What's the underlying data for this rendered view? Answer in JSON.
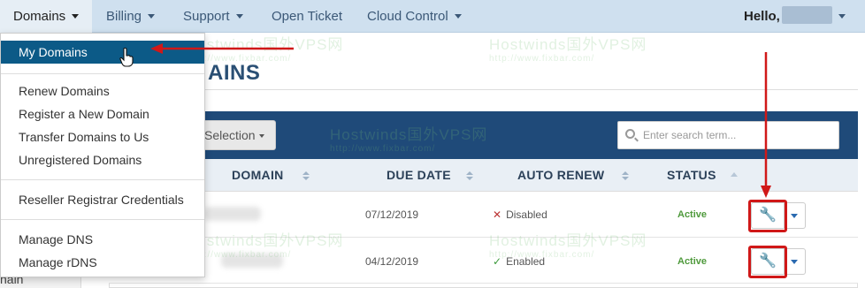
{
  "nav": {
    "items": [
      {
        "label": "Domains"
      },
      {
        "label": "Billing"
      },
      {
        "label": "Support"
      },
      {
        "label": "Open Ticket"
      },
      {
        "label": "Cloud Control"
      }
    ],
    "greeting": "Hello,"
  },
  "menu": {
    "items": [
      {
        "label": "My Domains"
      },
      {
        "label": "Renew Domains"
      },
      {
        "label": "Register a New Domain"
      },
      {
        "label": "Transfer Domains to Us"
      },
      {
        "label": "Unregistered Domains"
      },
      {
        "label": "Reseller Registrar Credentials"
      },
      {
        "label": "Manage DNS"
      },
      {
        "label": "Manage rDNS"
      }
    ]
  },
  "sidebar": {
    "partial_text": "nain"
  },
  "page": {
    "title_fragment": "AINS"
  },
  "toolbar": {
    "selection_label": "Selection",
    "search_placeholder": "Enter search term..."
  },
  "table": {
    "columns": [
      "DOMAIN",
      "DUE DATE",
      "AUTO RENEW",
      "STATUS"
    ],
    "rows": [
      {
        "due_date": "07/12/2019",
        "auto_renew": "Disabled",
        "status": "Active"
      },
      {
        "due_date": "04/12/2019",
        "auto_renew": "Enabled",
        "status": "Active"
      }
    ]
  },
  "watermark": {
    "main": "Hostwinds国外VPS网",
    "url": "http://www.fixbar.com/"
  },
  "colors": {
    "nav_bg": "#cfe0ef",
    "panel_header": "#1f4a79",
    "menu_active": "#0c5a87",
    "annotation": "#d01818",
    "status_active": "#4f9a3c"
  },
  "icons": {
    "row_action": "wrench-icon",
    "search": "search-icon"
  }
}
